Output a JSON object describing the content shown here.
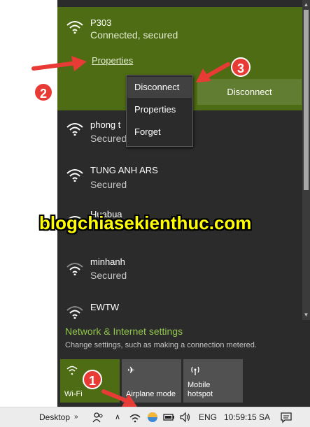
{
  "connected_network": {
    "name": "P303",
    "status": "Connected, secured",
    "properties_link": "Properties",
    "disconnect_button": "Disconnect"
  },
  "context_menu": {
    "items": [
      "Disconnect",
      "Properties",
      "Forget"
    ]
  },
  "networks": [
    {
      "name": "phong t",
      "status": "Secured"
    },
    {
      "name": "TUNG ANH ARS",
      "status": "Secured"
    },
    {
      "name": "Huabua",
      "status": ""
    },
    {
      "name": "minhanh",
      "status": "Secured"
    },
    {
      "name": "EWTW",
      "status": ""
    }
  ],
  "settings": {
    "title": "Network & Internet settings",
    "description": "Change settings, such as making a connection metered."
  },
  "quick_actions": [
    {
      "label": "Wi-Fi",
      "icon": "wifi-icon",
      "active": true
    },
    {
      "label": "Airplane mode",
      "icon": "airplane-icon",
      "active": false
    },
    {
      "label": "Mobile\nhotspot",
      "icon": "hotspot-icon",
      "active": false
    }
  ],
  "taskbar": {
    "desktop_label": "Desktop",
    "language": "ENG",
    "time": "10:59:15 SA"
  },
  "watermark": "blogchiasekienthuc.com",
  "annotations": [
    "1",
    "2",
    "3"
  ],
  "colors": {
    "accent": "#4d6c13",
    "flyout_bg": "#2b2b2b",
    "link": "#8fc54a",
    "annotation": "#e83b35",
    "watermark": "#ffff00"
  }
}
